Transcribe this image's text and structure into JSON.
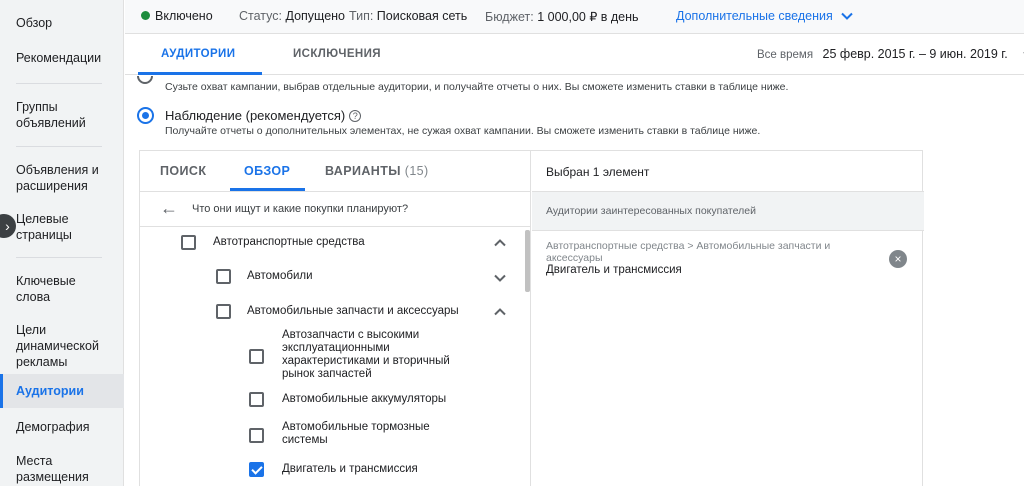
{
  "sidebar": {
    "items": [
      {
        "label": "Обзор"
      },
      {
        "label": "Рекомендации"
      },
      {
        "label": "Группы объявлений"
      },
      {
        "label": "Объявления и расширения"
      },
      {
        "label": "Целевые страницы"
      },
      {
        "label": "Ключевые слова"
      },
      {
        "label": "Цели динамической рекламы"
      },
      {
        "label": "Аудитории"
      },
      {
        "label": "Демография"
      },
      {
        "label": "Места размещения"
      }
    ],
    "active": "Аудитории",
    "collapse_icon": "chevron-right-icon"
  },
  "status": {
    "enabled": "Включено",
    "status_label": "Статус:",
    "status_value": "Допущено",
    "type_label": "Тип:",
    "type_value": "Поисковая сеть",
    "budget_label": "Бюджет:",
    "budget_value": "1 000,00 ₽ в день",
    "details_link": "Дополнительные сведения",
    "green": "#1e8e3e"
  },
  "tabs": {
    "audiences": "АУДИТОРИИ",
    "exclusions": "ИСКЛЮЧЕНИЯ",
    "date_label": "Все время",
    "date_range": "25 февр. 2015 г. – 9 июн. 2019 г."
  },
  "targeting": {
    "targeting_desc": "Сузьте охват кампании, выбрав отдельные аудитории, и получайте отчеты о них. Вы сможете изменить ставки в таблице ниже.",
    "observation_label": "Наблюдение (рекомендуется)",
    "observation_desc": "Получайте отчеты о дополнительных элементах, не сужая охват кампании. Вы сможете изменить ставки в таблице ниже."
  },
  "picker": {
    "tab_search": "ПОИСК",
    "tab_browse": "ОБЗОР",
    "tab_ideas": "ВАРИАНТЫ",
    "ideas_count": "(15)",
    "back_text": "Что они ищут и какие покупки планируют?",
    "tree": [
      {
        "label": "Автотранспортные средства",
        "checked": false
      },
      {
        "label": "Автомобили",
        "checked": false
      },
      {
        "label": "Автомобильные запчасти и аксессуары",
        "checked": false
      },
      {
        "label": "Автозапчасти с высокими эксплуатационными характеристиками и вторичный рынок запчастей",
        "checked": false
      },
      {
        "label": "Автомобильные аккумуляторы",
        "checked": false
      },
      {
        "label": "Автомобильные тормозные системы",
        "checked": false
      },
      {
        "label": "Двигатель и трансмиссия",
        "checked": true
      }
    ]
  },
  "selection": {
    "header": "Выбран 1 элемент",
    "category": "Аудитории заинтересованных покупателей",
    "path": "Автотранспортные средства > Автомобильные запчасти и аксессуары",
    "name": "Двигатель и трансмиссия"
  },
  "colors": {
    "accent": "#1a73e8"
  }
}
